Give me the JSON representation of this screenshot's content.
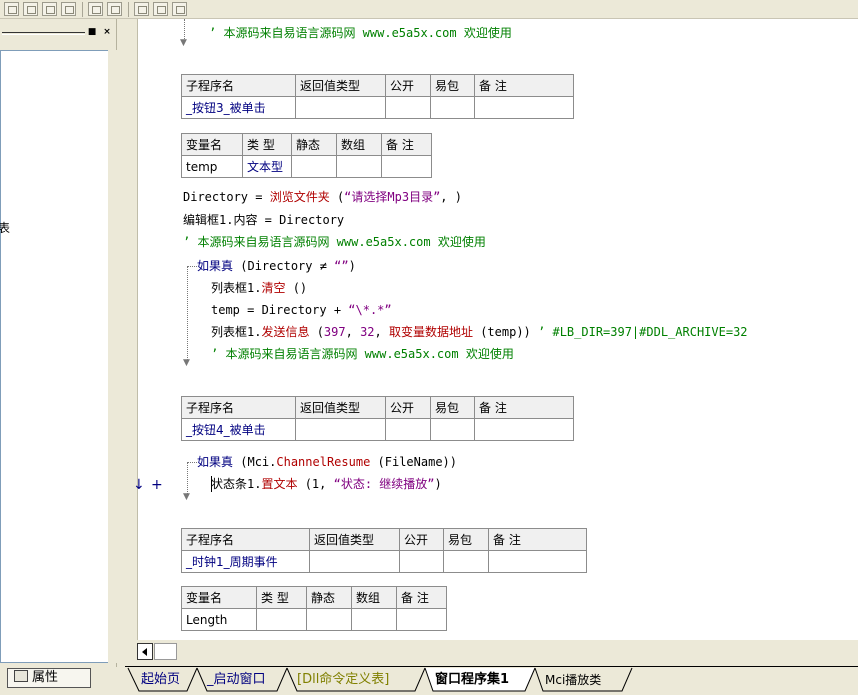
{
  "left_panel": {
    "truncated_text": "表",
    "properties_tab": "属性",
    "minimize_glyph": "■",
    "close_glyph": "×"
  },
  "sub1": {
    "comment_line": "’ 本源码来自易语言源码网 www.e5a5x.com  欢迎使用",
    "header": {
      "labels": [
        "子程序名",
        "返回值类型",
        "公开",
        "易包",
        "备 注"
      ],
      "name": "_按钮3_被单击"
    },
    "vars": {
      "labels": [
        "变量名",
        "类 型",
        "静态",
        "数组",
        "备 注"
      ],
      "name": "temp",
      "type": "文本型"
    },
    "lines": {
      "l1a": "Directory = ",
      "l1b": "浏览文件夹",
      "l1c": " (",
      "l1d": "“请选择Mp3目录”",
      "l1e": ", )",
      "l2": "编辑框1.内容 = Directory",
      "l3": "’ 本源码来自易语言源码网 www.e5a5x.com  欢迎使用",
      "l4a": "如果真",
      "l4b": " (Directory ≠ ",
      "l4c": "“”",
      "l4d": ")",
      "l5a": "列表框1.",
      "l5b": "清空",
      "l5c": " ()",
      "l6a": "temp = Directory + ",
      "l6b": "“\\*.*”",
      "l7a": "列表框1.",
      "l7b": "发送信息",
      "l7c": " (",
      "l7d": "397",
      "l7e": ", ",
      "l7f": "32",
      "l7g": ", ",
      "l7h": "取变量数据地址",
      "l7i": " (temp))  ",
      "l7j": "’ #LB_DIR=397|#DDL_ARCHIVE=32",
      "l8": "’ 本源码来自易语言源码网 www.e5a5x.com  欢迎使用"
    }
  },
  "sub2": {
    "header": {
      "labels": [
        "子程序名",
        "返回值类型",
        "公开",
        "易包",
        "备 注"
      ],
      "name": "_按钮4_被单击"
    },
    "lines": {
      "l1a": "如果真",
      "l1b": " (Mci.",
      "l1c": "ChannelResume",
      "l1d": " (FileName))",
      "l2a": "状态条1.",
      "l2b": "置文本",
      "l2c": " (1, ",
      "l2d": "“状态: 继续播放”",
      "l2e": ")"
    },
    "markers": {
      "arrow": "↓",
      "plus": "+"
    }
  },
  "sub3": {
    "header": {
      "labels": [
        "子程序名",
        "返回值类型",
        "公开",
        "易包",
        "备 注"
      ],
      "name": "_时钟1_周期事件"
    },
    "vars": {
      "labels": [
        "变量名",
        "类 型",
        "静态",
        "数组",
        "备 注"
      ],
      "name": "Length"
    }
  },
  "tabs": [
    {
      "label": "起始页"
    },
    {
      "label": "_启动窗口"
    },
    {
      "label": "[Dll命令定义表]"
    },
    {
      "label": "窗口程序集1"
    },
    {
      "label": "Mci播放类"
    }
  ]
}
